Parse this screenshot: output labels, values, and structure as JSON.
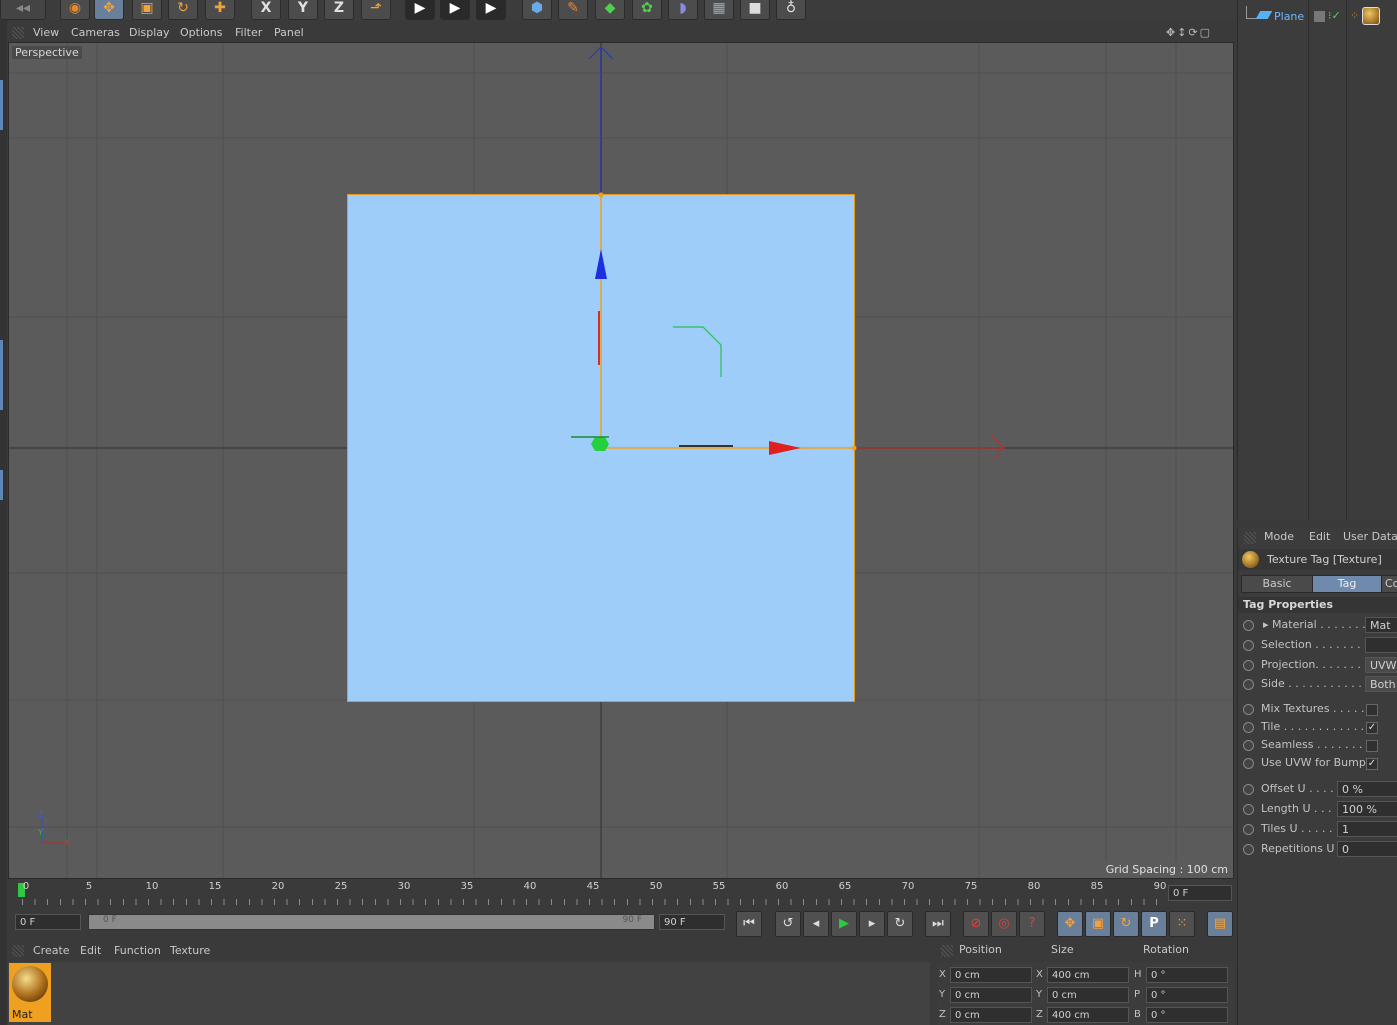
{
  "toolbar": {
    "icons": [
      "undo-icon",
      "select-arrow-icon",
      "move-icon",
      "scale-icon",
      "rotate-icon",
      "add-icon",
      "x-axis-lock-icon",
      "y-axis-lock-icon",
      "z-axis-lock-icon",
      "world-coord-icon",
      "render-view-icon",
      "render-picture-viewer-icon",
      "render-settings-icon",
      "cube-icon",
      "pen-icon",
      "subdivision-icon",
      "array-icon",
      "deformer-icon",
      "floor-icon",
      "camera-icon",
      "light-icon"
    ],
    "x_label": "X",
    "y_label": "Y",
    "z_label": "Z"
  },
  "viewport": {
    "menu": [
      "View",
      "Cameras",
      "Display",
      "Options",
      "Filter",
      "Panel"
    ],
    "label": "Perspective",
    "grid_spacing": "Grid Spacing : 100 cm",
    "mini_axis": {
      "z": "Z",
      "y": "Y",
      "x": "X"
    }
  },
  "object_manager": {
    "object_name": "Plane"
  },
  "attributes": {
    "menu": [
      "Mode",
      "Edit",
      "User Data"
    ],
    "title": "Texture Tag [Texture]",
    "tabs": [
      "Basic",
      "Tag",
      "Co"
    ],
    "active_tab": "Tag",
    "section": "Tag Properties",
    "props": [
      {
        "label": "Material . . . . . . .",
        "value": "Mat",
        "type": "field"
      },
      {
        "label": "Selection . . . . . . . .",
        "value": "",
        "type": "field"
      },
      {
        "label": "Projection. . . . . . .",
        "value": "UVW",
        "type": "field"
      },
      {
        "label": "Side . . . . . . . . . . . .",
        "value": "Both",
        "type": "field"
      },
      {
        "label": "Mix Textures . . . . .",
        "value": "",
        "type": "check"
      },
      {
        "label": "Tile . . . . . . . . . . . . .",
        "value": "✓",
        "type": "check"
      },
      {
        "label": "Seamless . . . . . . . .",
        "value": "",
        "type": "check"
      },
      {
        "label": "Use UVW for Bump",
        "value": "✓",
        "type": "check"
      },
      {
        "label": "Offset U . . . .",
        "value": "0 %",
        "type": "num"
      },
      {
        "label": "Length U . . .",
        "value": "100 %",
        "type": "num"
      },
      {
        "label": "Tiles U . . . . .",
        "value": "1",
        "type": "num"
      },
      {
        "label": "Repetitions U",
        "value": "0",
        "type": "num"
      }
    ]
  },
  "timeline": {
    "ticks": [
      "0",
      "5",
      "10",
      "15",
      "20",
      "25",
      "30",
      "35",
      "40",
      "45",
      "50",
      "55",
      "60",
      "65",
      "70",
      "75",
      "80",
      "85",
      "90"
    ],
    "current_frame": "0 F",
    "start_field": "0 F",
    "range_start": "0 F",
    "range_end": "90 F",
    "end_field": "90 F"
  },
  "transport": {
    "icons": [
      "go-start-icon",
      "prev-key-icon",
      "prev-frame-icon",
      "play-icon",
      "next-frame-icon",
      "next-key-icon",
      "go-end-icon",
      "record-icon",
      "autokey-icon",
      "keyframe-selection-icon",
      "move-key-icon",
      "scale-key-icon",
      "rotate-key-icon",
      "param-key-icon",
      "pla-key-icon",
      "timeline-icon"
    ],
    "param_label": "P"
  },
  "material_manager": {
    "menu": [
      "Create",
      "Edit",
      "Function",
      "Texture"
    ],
    "material_name": "Mat"
  },
  "coordinates": {
    "headers": [
      "Position",
      "Size",
      "Rotation"
    ],
    "rows": [
      {
        "axis": "X",
        "pos": "0 cm",
        "size_axis": "X",
        "size": "400 cm",
        "rot_axis": "H",
        "rot": "0 °"
      },
      {
        "axis": "Y",
        "pos": "0 cm",
        "size_axis": "Y",
        "size": "0 cm",
        "rot_axis": "P",
        "rot": "0 °"
      },
      {
        "axis": "Z",
        "pos": "0 cm",
        "size_axis": "Z",
        "size": "400 cm",
        "rot_axis": "B",
        "rot": "0 °"
      }
    ]
  }
}
